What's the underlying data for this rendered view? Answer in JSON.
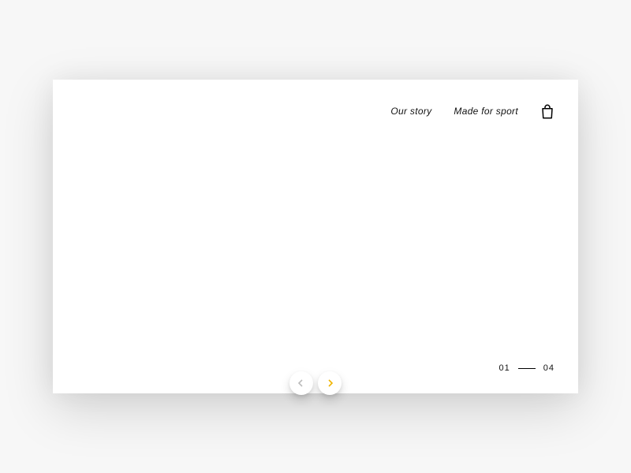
{
  "nav": {
    "links": [
      {
        "label": "Our story"
      },
      {
        "label": "Made for sport"
      }
    ]
  },
  "carousel": {
    "current": "01",
    "total": "04"
  }
}
